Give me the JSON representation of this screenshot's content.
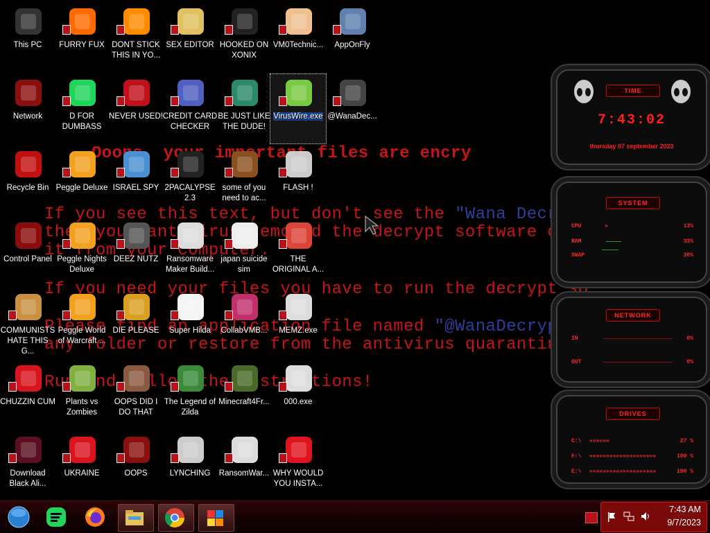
{
  "wallpaper": {
    "line1": "Ooops, your important files are encry",
    "line2a": "If you see this text, but don't see the ",
    "line2b": "\"Wana Decrypt",
    "line3": "then your antivirus removed the decrypt software or",
    "line4": "it from your computer.",
    "line5": "If you need your files you have to run the decrypt so",
    "line6a": "Please find an application file named ",
    "line6b": "\"@WanaDecrypto",
    "line7": "any folder or restore from the antivirus quarantine.",
    "line8": "Run and follow the instructions!"
  },
  "icons": [
    {
      "label": "This PC"
    },
    {
      "label": "FURRY FUX"
    },
    {
      "label": "DONT STICK THIS IN YO..."
    },
    {
      "label": "SEX EDITOR"
    },
    {
      "label": "HOOKED ON XONIX"
    },
    {
      "label": "VM0Technic..."
    },
    {
      "label": "AppOnFly"
    },
    {
      "label": "Network"
    },
    {
      "label": "D FOR DUMBASS"
    },
    {
      "label": "NEVER USED!"
    },
    {
      "label": "CREDIT CARD CHECKER"
    },
    {
      "label": "BE JUST LIKE THE DUDE!"
    },
    {
      "label": "VirusWire.exe"
    },
    {
      "label": "@WanaDec..."
    },
    {
      "label": "Recycle Bin"
    },
    {
      "label": "Peggle Deluxe"
    },
    {
      "label": "ISRAEL SPY"
    },
    {
      "label": "2PACALYPSE 2.3"
    },
    {
      "label": "some of you need to ac..."
    },
    {
      "label": "FLASH !"
    },
    {
      "label": "Control Panel"
    },
    {
      "label": "Peggle Nights Deluxe"
    },
    {
      "label": "DEEZ NUTZ"
    },
    {
      "label": "Ransomware Maker Build..."
    },
    {
      "label": "japan suicide sim"
    },
    {
      "label": "THE ORIGINAL A..."
    },
    {
      "label": "COMMUNISTS HATE THIS G..."
    },
    {
      "label": "Peggle World of Warcraft ..."
    },
    {
      "label": "DIE PLEASE"
    },
    {
      "label": "Super Hilda"
    },
    {
      "label": "CollabVMB..."
    },
    {
      "label": "MEMZ.exe"
    },
    {
      "label": "CHUZZIN CUM"
    },
    {
      "label": "Plants vs Zombies"
    },
    {
      "label": "OOPS DID I DO THAT"
    },
    {
      "label": "The Legend of Zilda"
    },
    {
      "label": "Minecraft4Fr..."
    },
    {
      "label": "000.exe"
    },
    {
      "label": "Download Black Ali..."
    },
    {
      "label": "UKRAINE"
    },
    {
      "label": "OOPS"
    },
    {
      "label": "LYNCHING"
    },
    {
      "label": "RansomWar..."
    },
    {
      "label": "WHY WOULD YOU INSTA..."
    }
  ],
  "widgets": {
    "time": {
      "title": "TIME",
      "clock": "7:43:02",
      "date": "thursday 07 september 2023"
    },
    "system": {
      "title": "SYSTEM",
      "rows": [
        {
          "k": "CPU",
          "v": "13%"
        },
        {
          "k": "RAM",
          "v": "33%"
        },
        {
          "k": "SWAP",
          "v": "30%"
        }
      ]
    },
    "network": {
      "title": "NETWORK",
      "rows": [
        {
          "k": "IN",
          "v": "0%"
        },
        {
          "k": "OUT",
          "v": "0%"
        }
      ]
    },
    "drives": {
      "title": "DRIVES",
      "rows": [
        {
          "k": "C:\\",
          "v": "27 %"
        },
        {
          "k": "F:\\",
          "v": "100 %"
        },
        {
          "k": "E:\\",
          "v": "100 %"
        }
      ]
    }
  },
  "taskbar": {
    "time": "7:43 AM",
    "date": "9/7/2023"
  },
  "colors": {
    "accent": "#c4151b",
    "taskbar": "#1a0303",
    "tray": "#7a0a0a"
  }
}
